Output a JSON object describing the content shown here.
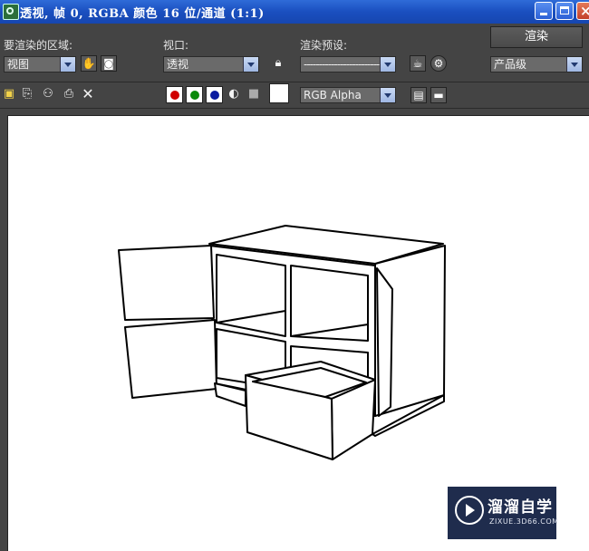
{
  "window": {
    "title": "透视, 帧 0, RGBA 颜色 16 位/通道 (1:1)",
    "controls": {
      "minimize": "minimize",
      "maximize": "maximize",
      "close": "×"
    }
  },
  "render_region": {
    "label": "要渲染的区域:",
    "value": "视图"
  },
  "viewport": {
    "label": "视口:",
    "value": "透视"
  },
  "preset": {
    "label": "渲染预设:",
    "value": "-------------------------"
  },
  "render_button": {
    "label": "渲染"
  },
  "production": {
    "value": "产品级"
  },
  "toolbar2": {
    "channel_select": "RGB Alpha",
    "close_glyph": "✕"
  },
  "channels": {
    "red": "#d00000",
    "green": "#0a8a0a",
    "blue": "#0a1aa0"
  },
  "watermark": {
    "title": "溜溜自学",
    "subtitle": "ZIXUE.3D66.COM"
  },
  "colors": {
    "titlebar": "#1a4fbf",
    "panel": "#444444",
    "canvas": "#ffffff"
  }
}
